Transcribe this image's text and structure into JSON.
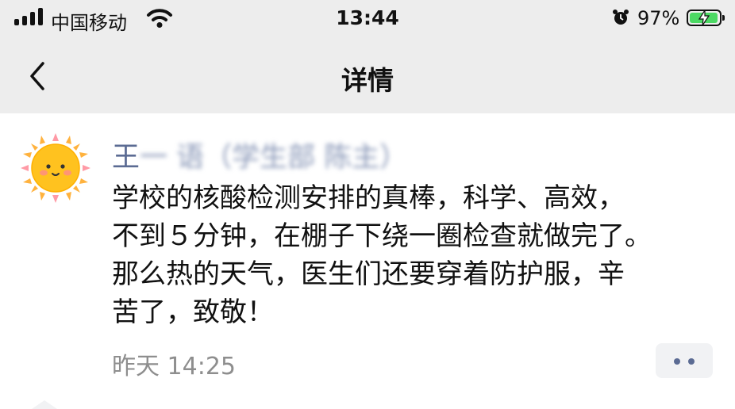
{
  "status_bar": {
    "carrier": "中国移动",
    "time": "13:44",
    "battery_percent": "97%",
    "battery_level": 0.97,
    "battery_color": "#4cd964",
    "icons": [
      "signal-icon",
      "wifi-icon",
      "alarm-icon",
      "battery-icon"
    ]
  },
  "nav": {
    "title": "详情",
    "back_icon": "chevron-left-icon"
  },
  "post": {
    "author_visible": "王",
    "author_blurred": "一 语（学生部 陈主）",
    "content_lines": [
      "学校的核酸检测安排的真棒，科学、高效，",
      "不到５分钟，在棚子下绕一圈检查就做完了。",
      "那么热的天气，医生们还要穿着防护服，辛",
      "苦了，致敬！"
    ],
    "timestamp": "昨天 14:25",
    "more_icon": "more-dots-icon",
    "name_color": "#5b6b93"
  }
}
